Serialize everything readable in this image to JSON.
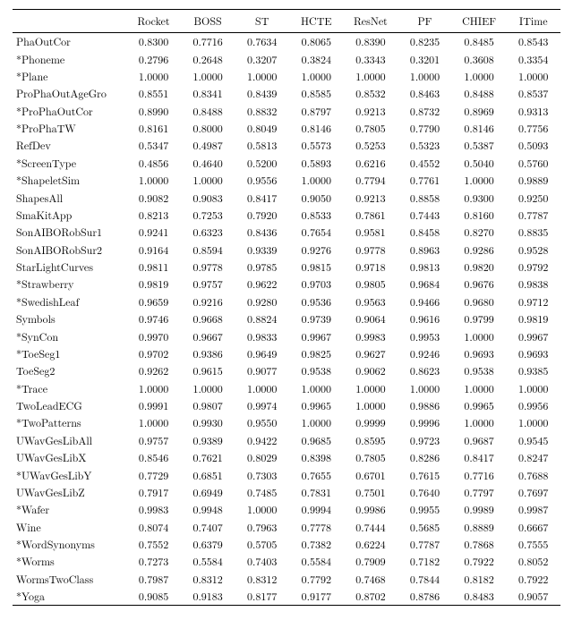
{
  "chart_data": {
    "type": "table",
    "columns": [
      "Rocket",
      "BOSS",
      "ST",
      "HCTE",
      "ResNet",
      "PF",
      "CHIEF",
      "ITime"
    ],
    "rows": [
      {
        "name": "PhaOutCor",
        "values": [
          "0.8300",
          "0.7716",
          "0.7634",
          "0.8065",
          "0.8390",
          "0.8235",
          "0.8485",
          "0.8543"
        ]
      },
      {
        "name": "*Phoneme",
        "values": [
          "0.2796",
          "0.2648",
          "0.3207",
          "0.3824",
          "0.3343",
          "0.3201",
          "0.3608",
          "0.3354"
        ]
      },
      {
        "name": "*Plane",
        "values": [
          "1.0000",
          "1.0000",
          "1.0000",
          "1.0000",
          "1.0000",
          "1.0000",
          "1.0000",
          "1.0000"
        ]
      },
      {
        "name": "ProPhaOutAgeGro",
        "values": [
          "0.8551",
          "0.8341",
          "0.8439",
          "0.8585",
          "0.8532",
          "0.8463",
          "0.8488",
          "0.8537"
        ]
      },
      {
        "name": "*ProPhaOutCor",
        "values": [
          "0.8990",
          "0.8488",
          "0.8832",
          "0.8797",
          "0.9213",
          "0.8732",
          "0.8969",
          "0.9313"
        ]
      },
      {
        "name": "*ProPhaTW",
        "values": [
          "0.8161",
          "0.8000",
          "0.8049",
          "0.8146",
          "0.7805",
          "0.7790",
          "0.8146",
          "0.7756"
        ]
      },
      {
        "name": "RefDev",
        "values": [
          "0.5347",
          "0.4987",
          "0.5813",
          "0.5573",
          "0.5253",
          "0.5323",
          "0.5387",
          "0.5093"
        ]
      },
      {
        "name": "*ScreenType",
        "values": [
          "0.4856",
          "0.4640",
          "0.5200",
          "0.5893",
          "0.6216",
          "0.4552",
          "0.5040",
          "0.5760"
        ]
      },
      {
        "name": "*ShapeletSim",
        "values": [
          "1.0000",
          "1.0000",
          "0.9556",
          "1.0000",
          "0.7794",
          "0.7761",
          "1.0000",
          "0.9889"
        ]
      },
      {
        "name": "ShapesAll",
        "values": [
          "0.9082",
          "0.9083",
          "0.8417",
          "0.9050",
          "0.9213",
          "0.8858",
          "0.9300",
          "0.9250"
        ]
      },
      {
        "name": "SmaKitApp",
        "values": [
          "0.8213",
          "0.7253",
          "0.7920",
          "0.8533",
          "0.7861",
          "0.7443",
          "0.8160",
          "0.7787"
        ]
      },
      {
        "name": "SonAIBORobSur1",
        "values": [
          "0.9241",
          "0.6323",
          "0.8436",
          "0.7654",
          "0.9581",
          "0.8458",
          "0.8270",
          "0.8835"
        ]
      },
      {
        "name": "SonAIBORobSur2",
        "values": [
          "0.9164",
          "0.8594",
          "0.9339",
          "0.9276",
          "0.9778",
          "0.8963",
          "0.9286",
          "0.9528"
        ]
      },
      {
        "name": "StarLightCurves",
        "values": [
          "0.9811",
          "0.9778",
          "0.9785",
          "0.9815",
          "0.9718",
          "0.9813",
          "0.9820",
          "0.9792"
        ]
      },
      {
        "name": "*Strawberry",
        "values": [
          "0.9819",
          "0.9757",
          "0.9622",
          "0.9703",
          "0.9805",
          "0.9684",
          "0.9676",
          "0.9838"
        ]
      },
      {
        "name": "*SwedishLeaf",
        "values": [
          "0.9659",
          "0.9216",
          "0.9280",
          "0.9536",
          "0.9563",
          "0.9466",
          "0.9680",
          "0.9712"
        ]
      },
      {
        "name": "Symbols",
        "values": [
          "0.9746",
          "0.9668",
          "0.8824",
          "0.9739",
          "0.9064",
          "0.9616",
          "0.9799",
          "0.9819"
        ]
      },
      {
        "name": "*SynCon",
        "values": [
          "0.9970",
          "0.9667",
          "0.9833",
          "0.9967",
          "0.9983",
          "0.9953",
          "1.0000",
          "0.9967"
        ]
      },
      {
        "name": "*ToeSeg1",
        "values": [
          "0.9702",
          "0.9386",
          "0.9649",
          "0.9825",
          "0.9627",
          "0.9246",
          "0.9693",
          "0.9693"
        ]
      },
      {
        "name": "ToeSeg2",
        "values": [
          "0.9262",
          "0.9615",
          "0.9077",
          "0.9538",
          "0.9062",
          "0.8623",
          "0.9538",
          "0.9385"
        ]
      },
      {
        "name": "*Trace",
        "values": [
          "1.0000",
          "1.0000",
          "1.0000",
          "1.0000",
          "1.0000",
          "1.0000",
          "1.0000",
          "1.0000"
        ]
      },
      {
        "name": "TwoLeadECG",
        "values": [
          "0.9991",
          "0.9807",
          "0.9974",
          "0.9965",
          "1.0000",
          "0.9886",
          "0.9965",
          "0.9956"
        ]
      },
      {
        "name": "*TwoPatterns",
        "values": [
          "1.0000",
          "0.9930",
          "0.9550",
          "1.0000",
          "0.9999",
          "0.9996",
          "1.0000",
          "1.0000"
        ]
      },
      {
        "name": "UWavGesLibAll",
        "values": [
          "0.9757",
          "0.9389",
          "0.9422",
          "0.9685",
          "0.8595",
          "0.9723",
          "0.9687",
          "0.9545"
        ]
      },
      {
        "name": "UWavGesLibX",
        "values": [
          "0.8546",
          "0.7621",
          "0.8029",
          "0.8398",
          "0.7805",
          "0.8286",
          "0.8417",
          "0.8247"
        ]
      },
      {
        "name": "*UWavGesLibY",
        "values": [
          "0.7729",
          "0.6851",
          "0.7303",
          "0.7655",
          "0.6701",
          "0.7615",
          "0.7716",
          "0.7688"
        ]
      },
      {
        "name": "UWavGesLibZ",
        "values": [
          "0.7917",
          "0.6949",
          "0.7485",
          "0.7831",
          "0.7501",
          "0.7640",
          "0.7797",
          "0.7697"
        ]
      },
      {
        "name": "*Wafer",
        "values": [
          "0.9983",
          "0.9948",
          "1.0000",
          "0.9994",
          "0.9986",
          "0.9955",
          "0.9989",
          "0.9987"
        ]
      },
      {
        "name": "Wine",
        "values": [
          "0.8074",
          "0.7407",
          "0.7963",
          "0.7778",
          "0.7444",
          "0.5685",
          "0.8889",
          "0.6667"
        ]
      },
      {
        "name": "*WordSynonyms",
        "values": [
          "0.7552",
          "0.6379",
          "0.5705",
          "0.7382",
          "0.6224",
          "0.7787",
          "0.7868",
          "0.7555"
        ]
      },
      {
        "name": "*Worms",
        "values": [
          "0.7273",
          "0.5584",
          "0.7403",
          "0.5584",
          "0.7909",
          "0.7182",
          "0.7922",
          "0.8052"
        ]
      },
      {
        "name": "WormsTwoClass",
        "values": [
          "0.7987",
          "0.8312",
          "0.8312",
          "0.7792",
          "0.7468",
          "0.7844",
          "0.8182",
          "0.7922"
        ]
      },
      {
        "name": "*Yoga",
        "values": [
          "0.9085",
          "0.9183",
          "0.8177",
          "0.9177",
          "0.8702",
          "0.8786",
          "0.8483",
          "0.9057"
        ]
      }
    ]
  }
}
